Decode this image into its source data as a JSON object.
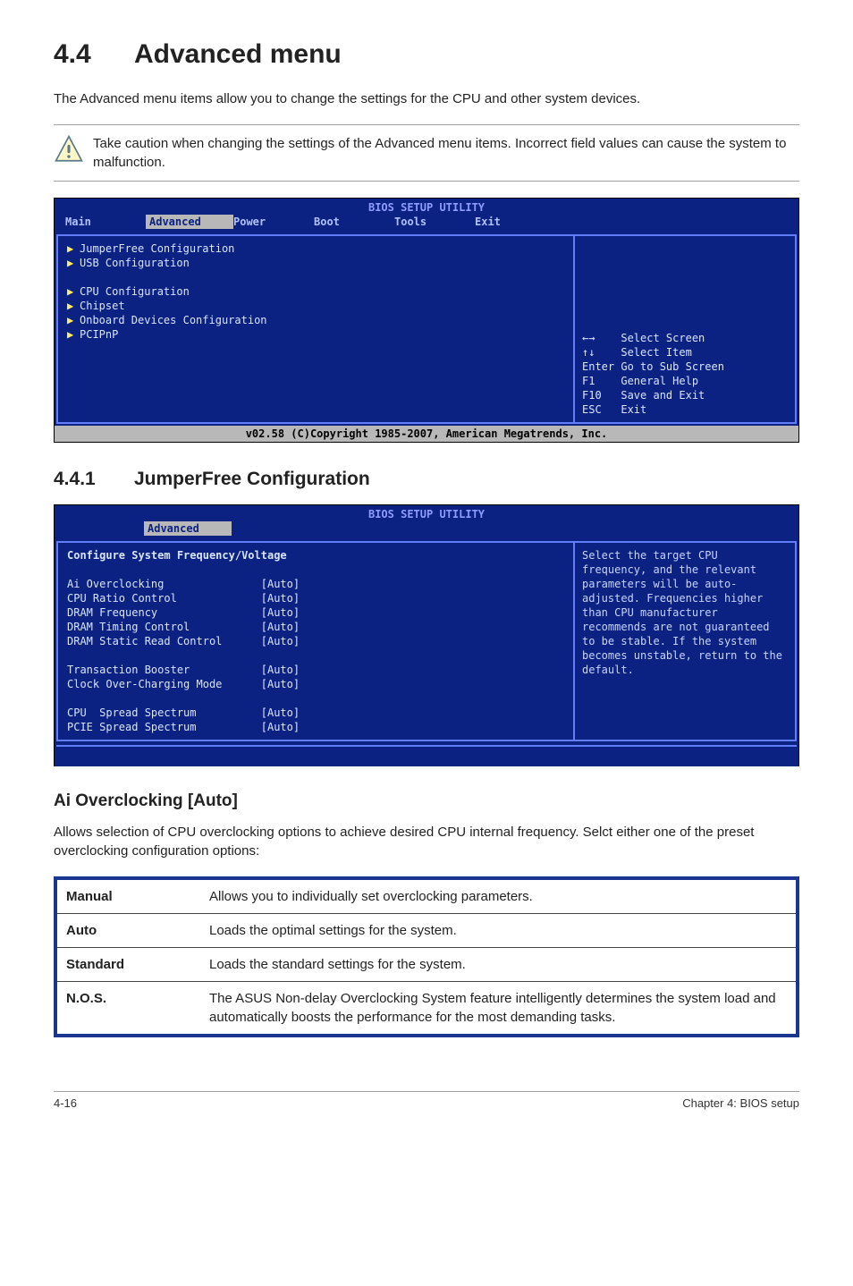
{
  "section": {
    "number": "4.4",
    "title": "Advanced menu",
    "intro": "The Advanced menu items allow you to change the settings for the CPU and other system devices.",
    "note": "Take caution when changing the settings of the Advanced menu items. Incorrect field values can cause the system to malfunction."
  },
  "bios1": {
    "title": "BIOS SETUP UTILITY",
    "tabs": [
      "Main",
      "Advanced",
      "Power",
      "Boot",
      "Tools",
      "Exit"
    ],
    "active_tab_index": 1,
    "items": [
      "JumperFree Configuration",
      "USB Configuration",
      "",
      "CPU Configuration",
      "Chipset",
      "Onboard Devices Configuration",
      "PCIPnP"
    ],
    "help": [
      "←→    Select Screen",
      "↑↓    Select Item",
      "Enter Go to Sub Screen",
      "F1    General Help",
      "F10   Save and Exit",
      "ESC   Exit"
    ],
    "footer": "v02.58 (C)Copyright 1985-2007, American Megatrends, Inc."
  },
  "subsection": {
    "number": "4.4.1",
    "title": "JumperFree Configuration"
  },
  "bios2": {
    "title": "BIOS SETUP UTILITY",
    "active_tab": "Advanced",
    "panel_title": "Configure System Frequency/Voltage",
    "rows": [
      {
        "label": "Ai Overclocking",
        "value": "[Auto]"
      },
      {
        "label": "CPU Ratio Control",
        "value": "[Auto]"
      },
      {
        "label": "DRAM Frequency",
        "value": "[Auto]"
      },
      {
        "label": "DRAM Timing Control",
        "value": "[Auto]"
      },
      {
        "label": "DRAM Static Read Control",
        "value": "[Auto]"
      },
      {
        "label": "",
        "value": ""
      },
      {
        "label": "Transaction Booster",
        "value": "[Auto]"
      },
      {
        "label": "Clock Over-Charging Mode",
        "value": "[Auto]"
      },
      {
        "label": "",
        "value": ""
      },
      {
        "label": "CPU  Spread Spectrum",
        "value": "[Auto]"
      },
      {
        "label": "PCIE Spread Spectrum",
        "value": "[Auto]"
      }
    ],
    "hint": "Select the target CPU frequency, and the relevant parameters will be auto-adjusted. Frequencies higher than CPU manufacturer recommends are not guaranteed to be stable. If the system becomes unstable, return to the default."
  },
  "ai": {
    "heading": "Ai Overclocking [Auto]",
    "desc": "Allows selection of CPU overclocking options to achieve desired CPU internal frequency. Selct either one of the preset overclocking configuration options:"
  },
  "options": [
    {
      "k": "Manual",
      "v": "Allows you to individually set overclocking parameters."
    },
    {
      "k": "Auto",
      "v": "Loads the optimal settings for the system."
    },
    {
      "k": "Standard",
      "v": "Loads the standard settings for the system."
    },
    {
      "k": "N.O.S.",
      "v": "The ASUS Non-delay Overclocking System feature intelligently determines the system load and automatically boosts the performance for the most demanding tasks."
    }
  ],
  "footer": {
    "left": "4-16",
    "right": "Chapter 4: BIOS setup"
  }
}
